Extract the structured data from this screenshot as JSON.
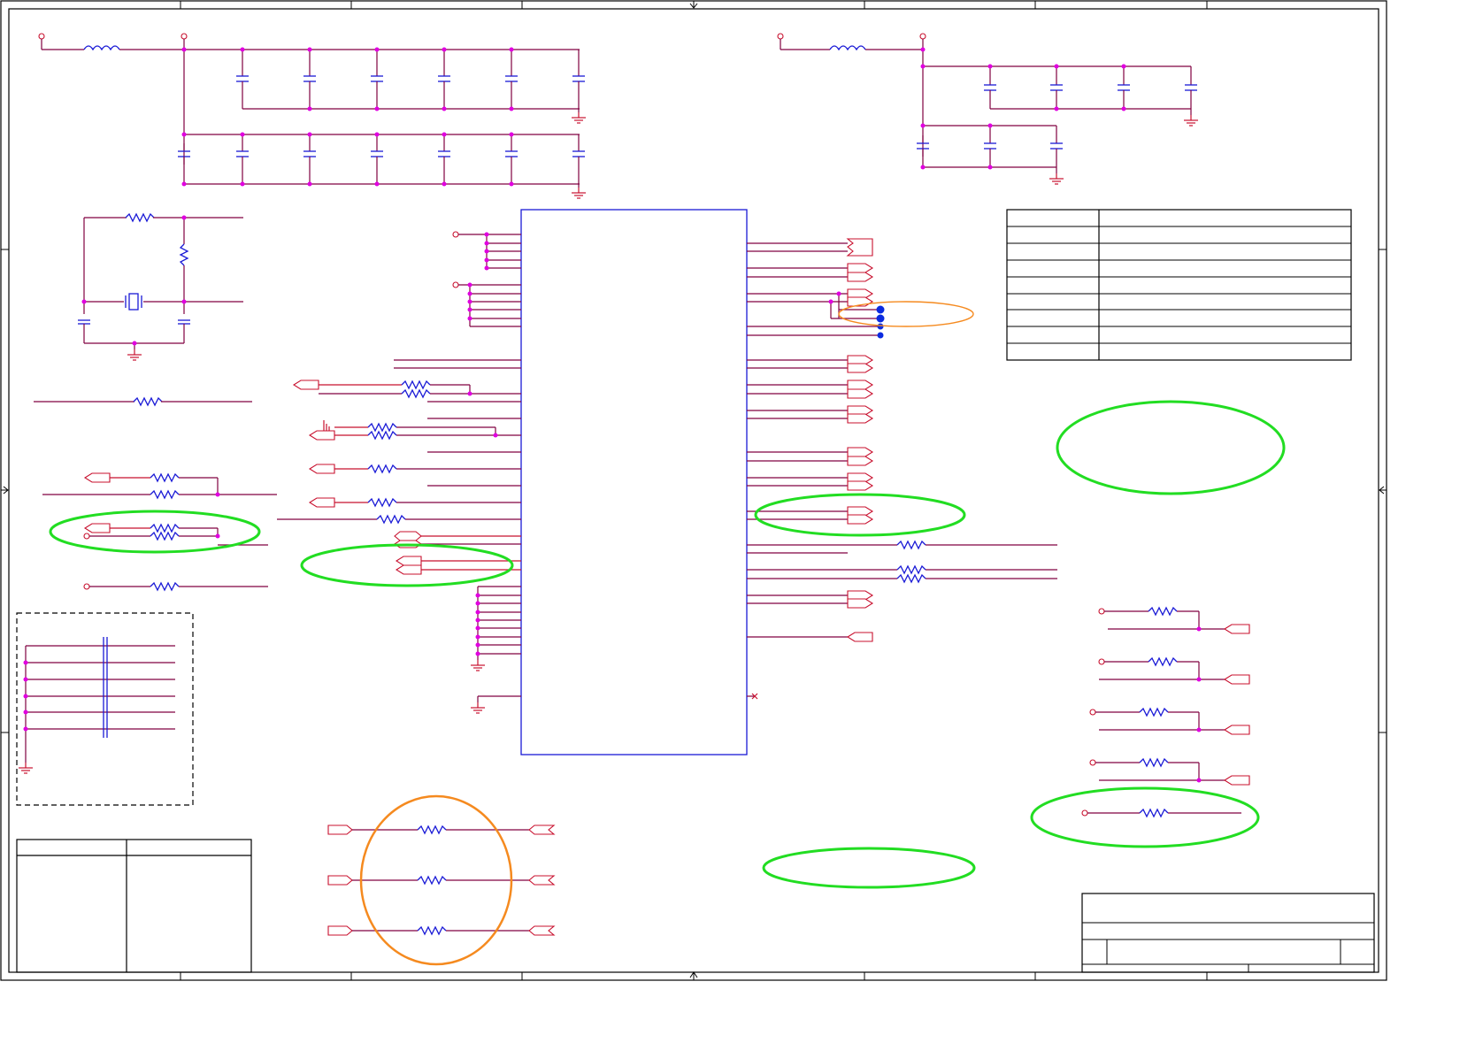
{
  "sheet": {
    "title": "",
    "colors": {
      "wire": "#800040",
      "pin": "#c8102e",
      "component": "#1a1ad6",
      "junction": "#e000e0",
      "highlight_green": "#22dd22",
      "highlight_orange": "#f58a1f",
      "ic_outline": "#1a1ad6"
    },
    "highlight_count": {
      "green": 6,
      "orange": 2
    },
    "icon_names": [
      "ground-symbol",
      "test-point",
      "net-port",
      "resistor",
      "capacitor",
      "inductor",
      "crystal"
    ]
  }
}
